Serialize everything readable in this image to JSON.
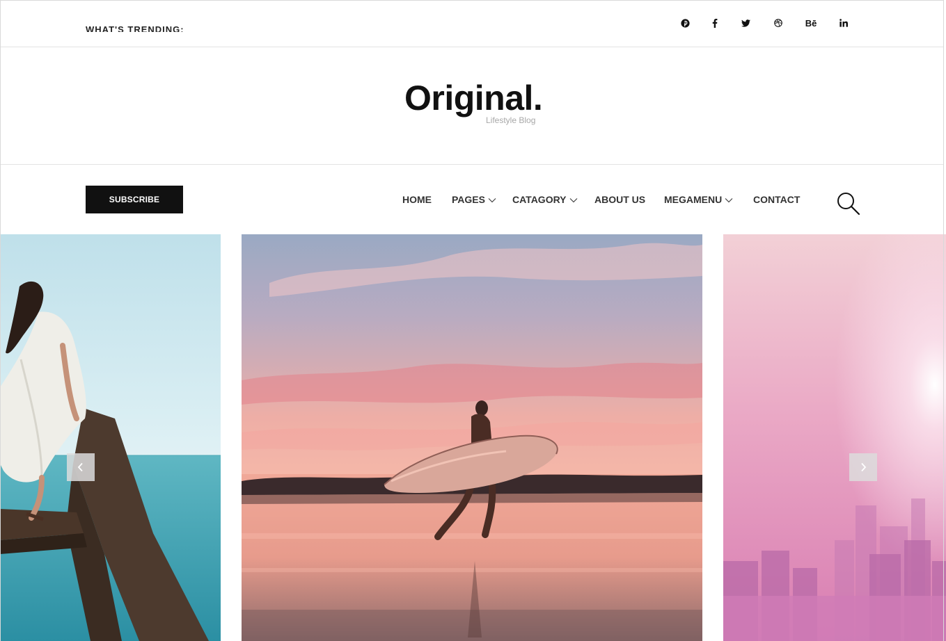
{
  "topbar": {
    "ticker_text": "WHAT'S TRENDING:",
    "social": [
      "pinterest-icon",
      "facebook-icon",
      "twitter-icon",
      "dribbble-icon",
      "behance-icon",
      "linkedin-icon"
    ],
    "behance_label": "Bē"
  },
  "brand": {
    "logo": "Original.",
    "tagline": "Lifestyle Blog"
  },
  "nav": {
    "subscribe_label": "SUBSCRIBE",
    "items": [
      {
        "label": "HOME",
        "dropdown": false
      },
      {
        "label": "PAGES",
        "dropdown": true
      },
      {
        "label": "CATAGORY",
        "dropdown": true
      },
      {
        "label": "ABOUT US",
        "dropdown": false
      },
      {
        "label": "MEGAMENU",
        "dropdown": true
      },
      {
        "label": "CONTACT",
        "dropdown": false
      }
    ],
    "search_icon": "search-icon"
  },
  "slider": {
    "slides": [
      {
        "subject": "woman-on-tree-by-sea"
      },
      {
        "subject": "surfer-at-sunset"
      },
      {
        "subject": "pink-city-skyline"
      }
    ],
    "prev_icon": "chevron-left-icon",
    "next_icon": "chevron-right-icon"
  },
  "colors": {
    "text": "#111111",
    "nav_text": "#333333",
    "tagline": "#a7a7a7",
    "button_bg": "#111111",
    "button_text": "#ffffff",
    "border": "#e3e3e3"
  }
}
